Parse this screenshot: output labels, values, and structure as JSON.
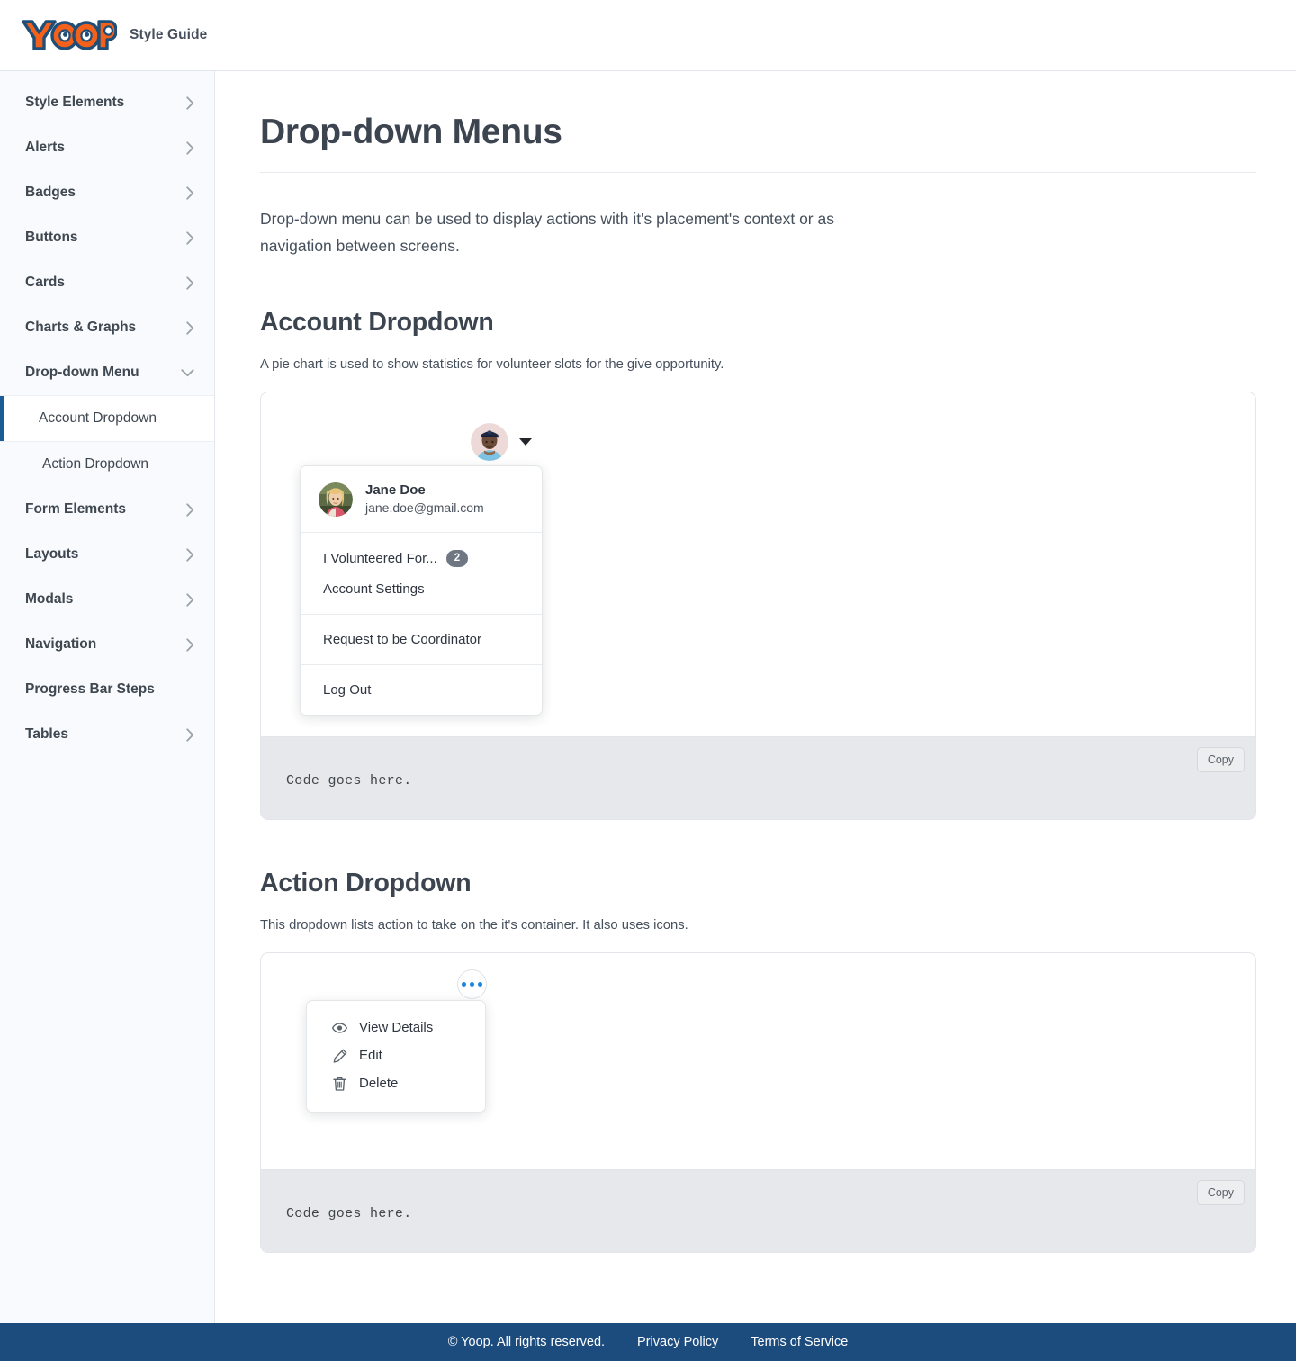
{
  "header": {
    "logo_text": "YOOP",
    "logo_colors": {
      "fill": "#f4611a",
      "outline": "#1f4e79"
    },
    "brand_subtitle": "Style Guide"
  },
  "sidebar": {
    "items": [
      {
        "label": "Style Elements",
        "icon": "chevron-right-icon",
        "expanded": false
      },
      {
        "label": "Alerts",
        "icon": "chevron-right-icon",
        "expanded": false
      },
      {
        "label": "Badges",
        "icon": "chevron-right-icon",
        "expanded": false
      },
      {
        "label": "Buttons",
        "icon": "chevron-right-icon",
        "expanded": false
      },
      {
        "label": "Cards",
        "icon": "chevron-right-icon",
        "expanded": false
      },
      {
        "label": "Charts & Graphs",
        "icon": "chevron-right-icon",
        "expanded": false
      },
      {
        "label": "Drop-down Menu",
        "icon": "chevron-down-icon",
        "expanded": true
      }
    ],
    "sub_items": [
      {
        "label": "Account Dropdown",
        "active": true
      },
      {
        "label": "Action Dropdown",
        "active": false
      }
    ],
    "items_after": [
      {
        "label": "Form Elements",
        "icon": "chevron-right-icon"
      },
      {
        "label": "Layouts",
        "icon": "chevron-right-icon"
      },
      {
        "label": "Modals",
        "icon": "chevron-right-icon"
      },
      {
        "label": "Navigation",
        "icon": "chevron-right-icon"
      },
      {
        "label": "Progress Bar Steps",
        "icon": ""
      },
      {
        "label": "Tables",
        "icon": "chevron-right-icon"
      }
    ],
    "active_indicator_color": "#1c5c96"
  },
  "main": {
    "page_title": "Drop-down Menus",
    "intro": "Drop-down menu can be used to display actions with it's placement's context or as navigation between screens.",
    "sections": [
      {
        "heading": "Account Dropdown",
        "description": "A pie chart is used to show statistics for volunteer slots for the give opportunity.",
        "code_text": "Code goes here.",
        "copy_label": "Copy"
      },
      {
        "heading": "Action Dropdown",
        "description": "This dropdown lists action to take on the it's container. It also uses icons.",
        "code_text": "Code goes here.",
        "copy_label": "Copy"
      }
    ]
  },
  "account_dropdown": {
    "trigger_avatar": "avatar-man-cap",
    "trigger_caret": "caret-down-icon",
    "user": {
      "avatar": "avatar-woman-blonde",
      "name": "Jane Doe",
      "email": "jane.doe@gmail.com"
    },
    "groups": [
      [
        {
          "label": "I Volunteered For...",
          "badge": "2"
        },
        {
          "label": "Account Settings",
          "badge": ""
        }
      ],
      [
        {
          "label": "Request to be Coordinator",
          "badge": ""
        }
      ],
      [
        {
          "label": "Log Out",
          "badge": ""
        }
      ]
    ],
    "badge_color": "#6e7782"
  },
  "action_dropdown": {
    "trigger_icon": "ellipsis-horizontal-icon",
    "trigger_dot_color": "#1b86e0",
    "items": [
      {
        "label": "View Details",
        "icon": "eye-icon"
      },
      {
        "label": "Edit",
        "icon": "pencil-icon"
      },
      {
        "label": "Delete",
        "icon": "trash-icon"
      }
    ]
  },
  "footer": {
    "background": "#1c4b7e",
    "copyright": "© Yoop. All rights reserved.",
    "links": [
      {
        "label": "Privacy Policy"
      },
      {
        "label": "Terms of Service"
      }
    ]
  }
}
